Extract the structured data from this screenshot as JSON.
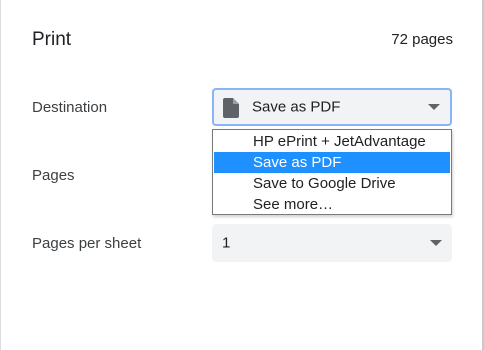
{
  "header": {
    "title": "Print",
    "page_count": "72 pages"
  },
  "destination": {
    "label": "Destination",
    "selected_value": "Save as PDF",
    "icon": "document-icon",
    "options": [
      "HP ePrint + JetAdvantage",
      "Save as PDF",
      "Save to Google Drive",
      "See more…"
    ],
    "highlighted_index": 1
  },
  "pages": {
    "label": "Pages"
  },
  "pages_per_sheet": {
    "label": "Pages per sheet",
    "selected_value": "1"
  },
  "colors": {
    "focus_border": "#8ab4f8",
    "highlight": "#1e90ff",
    "select_bg": "#f1f3f4"
  }
}
